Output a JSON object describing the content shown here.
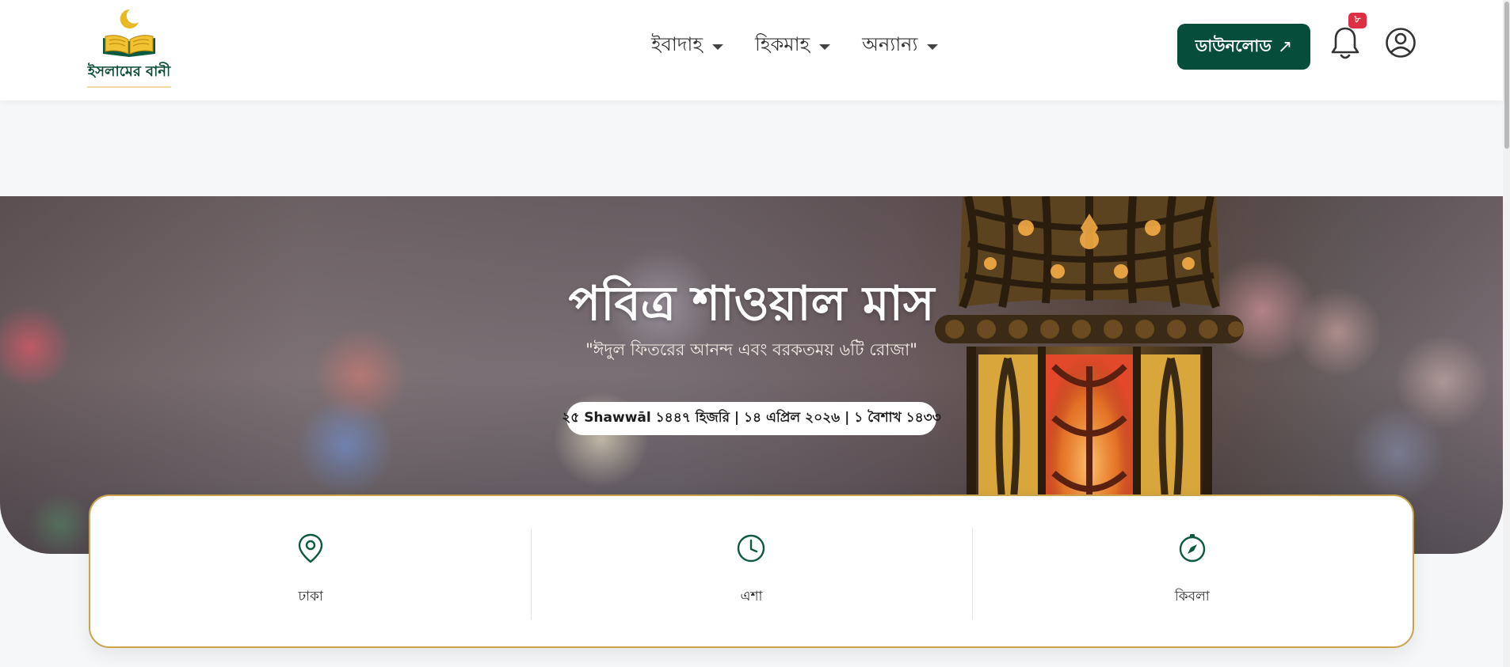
{
  "logo": {
    "text": "ইসলামের বানী"
  },
  "nav": [
    {
      "label": "ইবাদাহ"
    },
    {
      "label": "হিকমাহ"
    },
    {
      "label": "অন্যান্য"
    }
  ],
  "header": {
    "download_label": "ডাউনলোড",
    "download_arrow": "↗",
    "notification_count": "৮"
  },
  "hero": {
    "title": "পবিত্র শাওয়াল মাস",
    "subtitle": "\"ঈদুল ফিতরের আনন্দ এবং বরকতময় ৬টি রোজা\"",
    "date": "২৫ Shawwāl ১৪৪৭ হিজরি | ১৪ এপ্রিল ২০২৬ | ১ বৈশাখ ১৪৩৩"
  },
  "info": [
    {
      "label": "ঢাকা",
      "icon": "location-pin-icon"
    },
    {
      "label": "এশা",
      "icon": "clock-icon"
    },
    {
      "label": "কিবলা",
      "icon": "compass-icon"
    }
  ],
  "colors": {
    "brand": "#064e3b",
    "badge": "#dc2f43",
    "card_border": "#c9a44c"
  }
}
